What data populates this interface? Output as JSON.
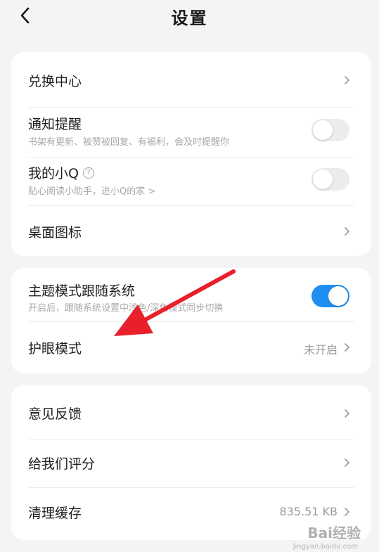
{
  "header": {
    "title": "设置",
    "back_icon": "chevron-left-icon"
  },
  "group1": {
    "exchange_center": {
      "label": "兑换中心"
    },
    "notifications": {
      "label": "通知提醒",
      "subtitle": "书架有更新、被赞被回复、有福利，会及时提醒你",
      "enabled": false
    },
    "my_xiaoq": {
      "label": "我的小Q",
      "help_glyph": "?",
      "subtitle": "贴心阅读小助手，进小Q的家 >",
      "enabled": false
    },
    "desktop_icon": {
      "label": "桌面图标"
    }
  },
  "group2": {
    "theme_follow_system": {
      "label": "主题模式跟随系统",
      "subtitle": "开启后，跟随系统设置中浅色/深色模式同步切换",
      "enabled": true
    },
    "eye_care": {
      "label": "护眼模式",
      "value": "未开启"
    }
  },
  "group3": {
    "feedback": {
      "label": "意见反馈"
    },
    "rate_us": {
      "label": "给我们评分"
    },
    "clear_cache": {
      "label": "清理缓存",
      "value": "835.51 KB"
    }
  },
  "colors": {
    "background": "#f4f4f5",
    "card": "#ffffff",
    "toggle_on": "#1e8ff0",
    "toggle_off": "#ececec",
    "annotation_arrow": "#e8202b"
  },
  "watermark": {
    "text": "Bai经验",
    "sub": "jingyan.baidu.com"
  }
}
